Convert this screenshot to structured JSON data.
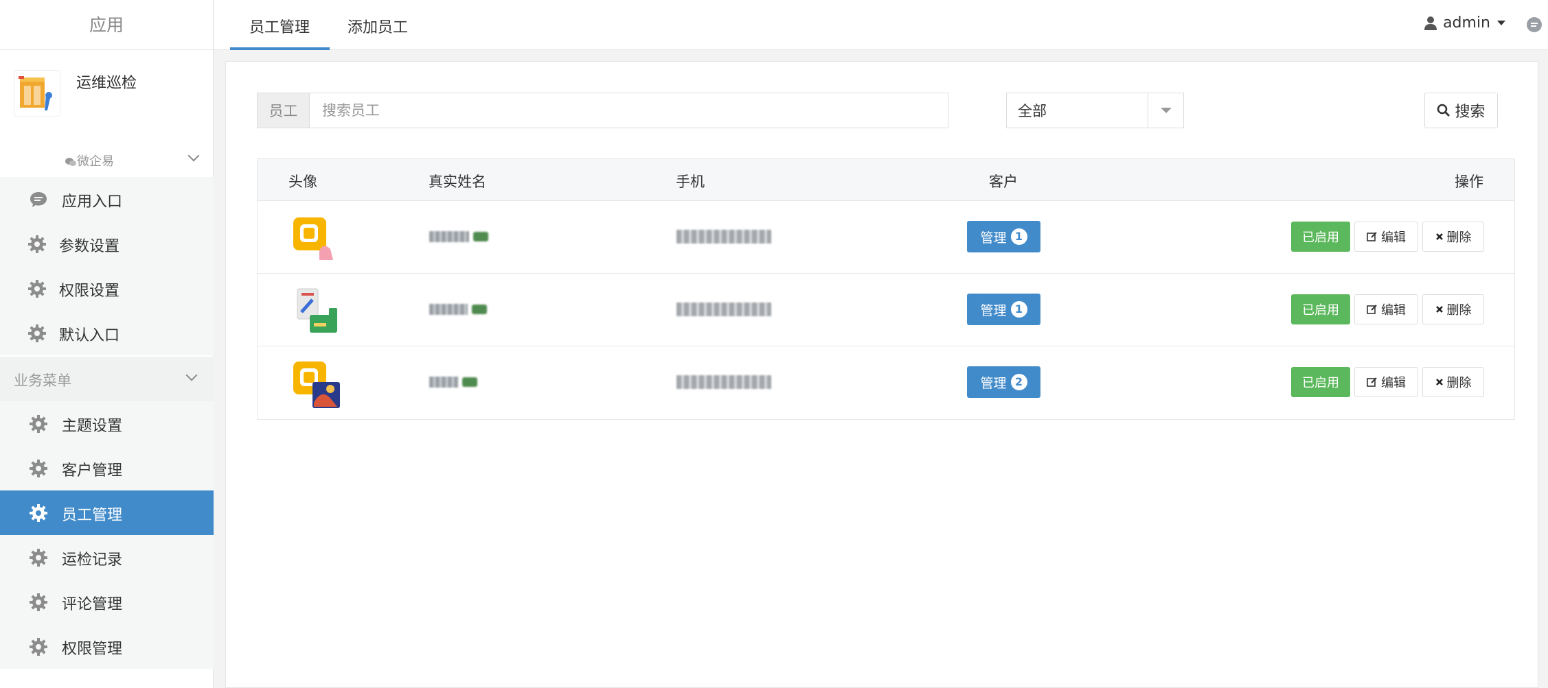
{
  "sidebar": {
    "title": "应用",
    "app_name": "运维巡检",
    "group1_label": "微企易",
    "group1_items": [
      {
        "label": "应用入口",
        "icon": "chat-bubble-icon"
      },
      {
        "label": "参数设置",
        "icon": "gear-icon"
      },
      {
        "label": "权限设置",
        "icon": "gear-icon"
      },
      {
        "label": "默认入口",
        "icon": "gear-icon"
      }
    ],
    "group2_label": "业务菜单",
    "group2_items": [
      {
        "label": "主题设置",
        "icon": "gear-icon"
      },
      {
        "label": "客户管理",
        "icon": "gear-icon"
      },
      {
        "label": "员工管理",
        "icon": "gear-icon",
        "active": true
      },
      {
        "label": "运检记录",
        "icon": "gear-icon"
      },
      {
        "label": "评论管理",
        "icon": "gear-icon"
      },
      {
        "label": "权限管理",
        "icon": "gear-icon"
      }
    ]
  },
  "header": {
    "tabs": [
      {
        "label": "员工管理",
        "active": true
      },
      {
        "label": "添加员工",
        "active": false
      }
    ],
    "user": "admin"
  },
  "filters": {
    "search_addon": "员工",
    "search_placeholder": "搜索员工",
    "search_value": "",
    "select_value": "全部",
    "search_button": "搜索"
  },
  "table": {
    "columns": [
      "头像",
      "真实姓名",
      "手机",
      "客户",
      "操作"
    ],
    "rows": [
      {
        "manage_label": "管理",
        "customer_count": "1",
        "status": "已启用",
        "edit": "编辑",
        "delete": "删除"
      },
      {
        "manage_label": "管理",
        "customer_count": "1",
        "status": "已启用",
        "edit": "编辑",
        "delete": "删除"
      },
      {
        "manage_label": "管理",
        "customer_count": "2",
        "status": "已启用",
        "edit": "编辑",
        "delete": "删除"
      }
    ]
  },
  "colors": {
    "primary": "#428bca",
    "success": "#5cb85c",
    "sidebar_bg": "#f5f7f7"
  }
}
